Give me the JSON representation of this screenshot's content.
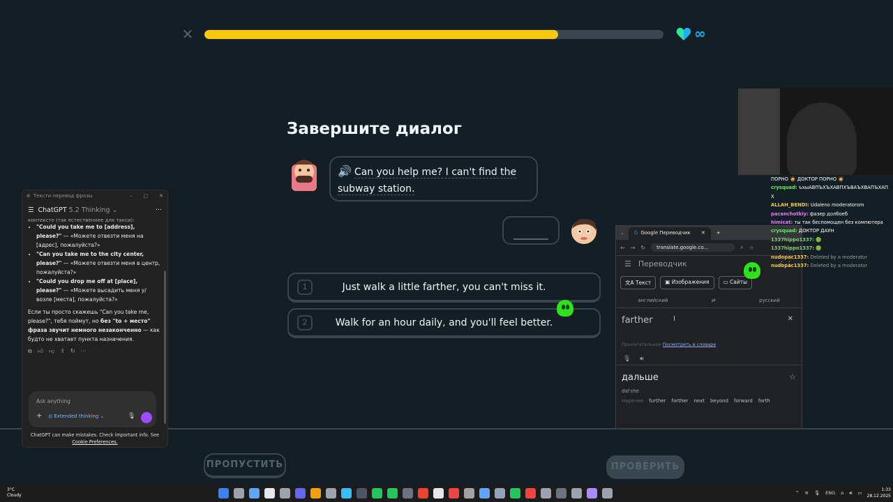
{
  "lesson": {
    "progress": 0.77,
    "hearts": "∞",
    "prompt_title": "Завершите диалог",
    "bubble_line1": "Can you help me? I can't find the",
    "bubble_line2": "subway station.",
    "options": [
      {
        "num": "1",
        "text": "Just walk a little farther, you can't miss it."
      },
      {
        "num": "2",
        "text": "Walk for an hour daily, and you'll feel better."
      }
    ],
    "skip_label": "ПРОПУСТИТЬ",
    "check_label": "ПРОВЕРИТЬ"
  },
  "chatgpt": {
    "window_title": "Тексти перевод фразы",
    "model": "ChatGPT",
    "model_version": "5.2 Thinking",
    "top_cut": "контексте (так естественнее для такси):",
    "bullets": [
      {
        "en": "\"Could you take me to [address], please?\"",
        "ru": "— «Можете отвезти меня на [адрес], пожалуйста?»"
      },
      {
        "en": "\"Can you take me to the city center, please?\"",
        "ru": "— «Можете отвезти меня в центр, пожалуйста?»"
      },
      {
        "en": "\"Could you drop me off at [place], please?\"",
        "ru": "— «Можете высадить меня у/возле [места], пожалуйста?»"
      }
    ],
    "para_start": "Если ты просто скажешь \"Can you take me, please?\", тебя поймут, но ",
    "para_bold1": "без \"to + место\"",
    "para_mid": " ",
    "para_bold2": "фраза звучит немного незаконченно",
    "para_end": " — как будто не хватает пункта назначения.",
    "input_placeholder": "Ask anything",
    "extended_label": "Extended thinking",
    "footer_text": "ChatGPT can make mistakes. Check important info. See",
    "footer_link": "Cookie Preferences."
  },
  "translate": {
    "tab_title": "Google Переводчик",
    "url": "translate.google.co...",
    "app_title": "Переводчик",
    "modes": [
      "Текст",
      "Изображения",
      "Сайты"
    ],
    "src_lang": "английский",
    "dst_lang": "русский",
    "source_text": "farther",
    "hint_label": "Прилагательное",
    "hint_link": "Посмотреть в словаре",
    "result": "дальше",
    "translit": "dal'she",
    "variants_label": "Наречие",
    "variants": [
      "further",
      "farther",
      "next",
      "beyond",
      "forward",
      "forth"
    ]
  },
  "stream_chat": {
    "header": "ПОРНО 🧔 ДОКТОР ПОРНО 🧔",
    "messages": [
      {
        "user": "crysquad:",
        "text": "ъхыАВПЪХЪХАВПХЪВАЪХВАПЪХАП",
        "color": "u"
      },
      {
        "user": "",
        "text": "X",
        "color": "u"
      },
      {
        "user": "ALLAH_BENDI:",
        "text": "Udaleno moderatorom",
        "color": "u o"
      },
      {
        "user": "pacanchotkiy:",
        "text": "фазер долбоеб",
        "color": "u p"
      },
      {
        "user": "himicat:",
        "text": "ты так беспомощен без компютера",
        "color": "u p"
      },
      {
        "user": "crysquad:",
        "text": "ДОКТОР ДАУН",
        "color": "u"
      },
      {
        "user": "1337hippo1337:",
        "text": "🟢",
        "color": "u g"
      },
      {
        "user": "1337hippo1337:",
        "text": "🟢",
        "color": "u g"
      },
      {
        "user": "nudopac1337:",
        "text": "Deleted by a moderator",
        "color": "u o"
      },
      {
        "user": "nudopac1337:",
        "text": "Deleted by a moderator",
        "color": "u o"
      }
    ]
  },
  "taskbar": {
    "temp": "3°C",
    "weather": "Cloudy",
    "lang": "ENG",
    "time": "1:33",
    "date": "28.12.2025"
  },
  "colors": {
    "background": "#131f24",
    "progress": "#f6c90e",
    "accent_blue": "#1cb0f6",
    "border": "#37464f"
  }
}
